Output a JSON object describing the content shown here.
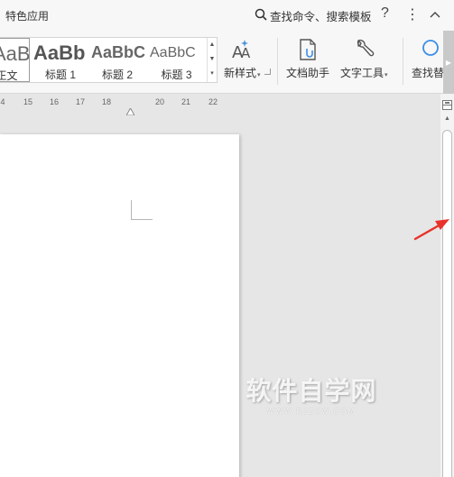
{
  "menubar": {
    "app_tab_label": "特色应用",
    "search_label": "查找命令、搜索模板",
    "help_label": "?",
    "more_label": "⋮"
  },
  "ribbon": {
    "styles": [
      {
        "preview": "AaBb",
        "name": "正文"
      },
      {
        "preview": "AaBb",
        "name": "标题 1"
      },
      {
        "preview": "AaBbC",
        "name": "标题 2"
      },
      {
        "preview": "AaBbC",
        "name": "标题 3"
      }
    ],
    "new_style_label": "新样式",
    "doc_assistant_label": "文档助手",
    "text_tools_label": "文字工具",
    "find_replace_label": "查找替"
  },
  "ruler": {
    "numbers": [
      "4",
      "15",
      "16",
      "17",
      "18",
      "20",
      "21",
      "22"
    ]
  },
  "watermark": {
    "main": "软件自学网",
    "sub": "WWW.RJZXW.COM"
  },
  "colors": {
    "arrow": "#e8332a",
    "workspace": "#e6e6e6",
    "ribbon": "#f7f7f7"
  }
}
